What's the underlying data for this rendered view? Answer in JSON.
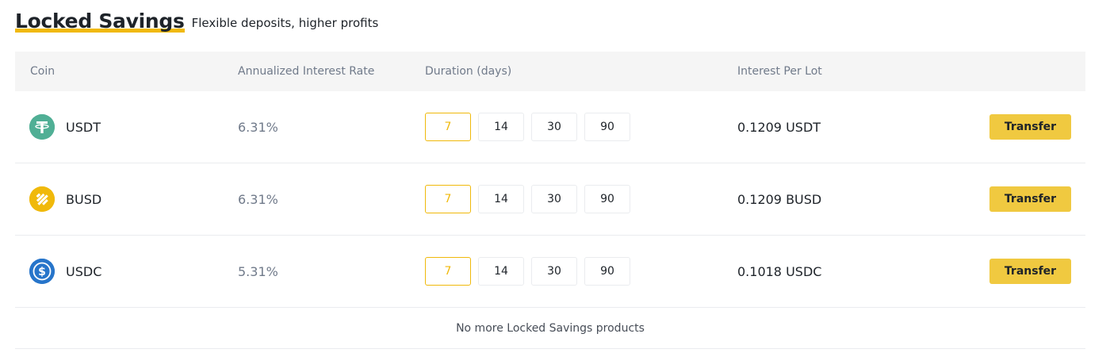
{
  "header": {
    "title": "Locked Savings",
    "subtitle": "Flexible deposits, higher profits"
  },
  "table": {
    "columns": {
      "coin": "Coin",
      "rate": "Annualized Interest Rate",
      "duration": "Duration (days)",
      "interest": "Interest Per Lot"
    },
    "rows": [
      {
        "coin": "USDT",
        "icon": "tether-icon",
        "icon_color": "#50af95",
        "rate": "6.31%",
        "durations": [
          "7",
          "14",
          "30",
          "90"
        ],
        "selected_duration": "7",
        "interest": "0.1209 USDT",
        "action": "Transfer"
      },
      {
        "coin": "BUSD",
        "icon": "busd-icon",
        "icon_color": "#f0b90b",
        "rate": "6.31%",
        "durations": [
          "7",
          "14",
          "30",
          "90"
        ],
        "selected_duration": "7",
        "interest": "0.1209 BUSD",
        "action": "Transfer"
      },
      {
        "coin": "USDC",
        "icon": "usdc-icon",
        "icon_color": "#2775ca",
        "rate": "5.31%",
        "durations": [
          "7",
          "14",
          "30",
          "90"
        ],
        "selected_duration": "7",
        "interest": "0.1018 USDC",
        "action": "Transfer"
      }
    ],
    "footer": "No more Locked Savings products"
  },
  "colors": {
    "accent": "#f0b90b",
    "button": "#f0c940",
    "header_bg": "#f5f5f5",
    "muted_text": "#707a8a"
  }
}
